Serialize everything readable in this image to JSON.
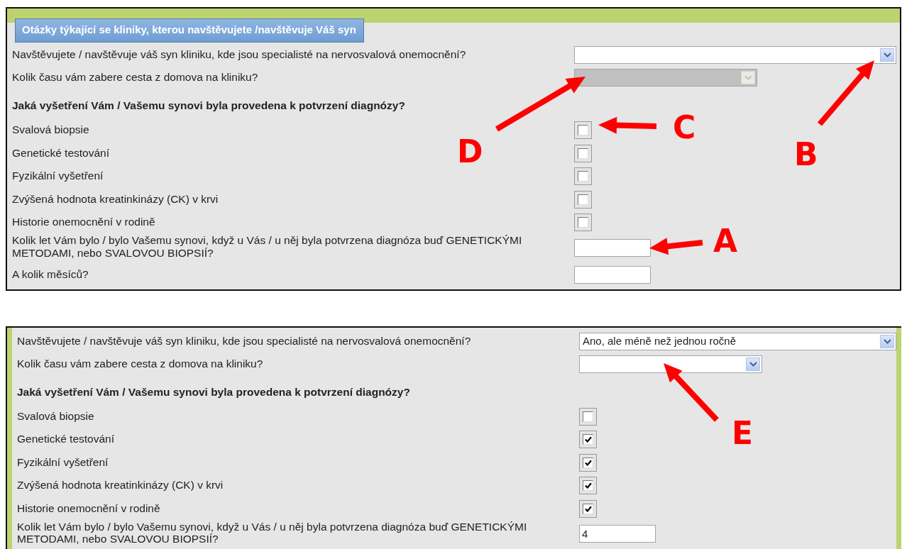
{
  "panels": [
    {
      "legend": "Otázky týkající se kliniky, kterou navštěvujete /navštěvuje Váš syn",
      "questions": [
        {
          "kind": "select",
          "label": "Navštěvujete / navštěvuje váš syn kliniku, kde jsou specialisté na nervosvalová onemocnění?",
          "disabled": false
        },
        {
          "kind": "smallselect",
          "label": "Kolik času vám zabere cesta z domova na kliniku?",
          "disabled": true
        },
        {
          "kind": "heading",
          "label": "Jaká vyšetření Vám / Vašemu synovi byla provedena k potvrzení diagnózy?"
        },
        {
          "kind": "checkbox",
          "label": "Svalová biopsie",
          "checked": false
        },
        {
          "kind": "checkbox",
          "label": "Genetické testování",
          "checked": false
        },
        {
          "kind": "checkbox",
          "label": "Fyzikální vyšetření",
          "checked": false
        },
        {
          "kind": "checkbox",
          "label": "Zvýšená hodnota kreatinkinázy (CK) v krvi",
          "checked": false
        },
        {
          "kind": "checkbox",
          "label": "Historie onemocnění v rodině",
          "checked": false
        },
        {
          "kind": "text",
          "label": "Kolik let Vám bylo / bylo Vašemu synovi, když u Vás / u něj byla potvrzena diagnóza buď GENETICKÝMI METODAMI, nebo SVALOVOU BIOPSIÍ?"
        },
        {
          "kind": "text",
          "label": "A kolik měsíců?"
        }
      ]
    },
    {
      "questions": [
        {
          "kind": "select",
          "label": "Navštěvujete / navštěvuje váš syn kliniku, kde jsou specialisté na nervosvalová onemocnění?",
          "value": "Ano, ale méně než jednou ročně",
          "disabled": false
        },
        {
          "kind": "smallselect",
          "label": "Kolik času vám zabere cesta z domova na kliniku?",
          "disabled": false
        },
        {
          "kind": "heading",
          "label": "Jaká vyšetření Vám / Vašemu synovi byla provedena k potvrzení diagnózy?"
        },
        {
          "kind": "checkbox",
          "label": "Svalová biopsie",
          "checked": false
        },
        {
          "kind": "checkbox",
          "label": "Genetické testování",
          "checked": true
        },
        {
          "kind": "checkbox",
          "label": "Fyzikální vyšetření",
          "checked": true
        },
        {
          "kind": "checkbox",
          "label": "Zvýšená hodnota kreatinkinázy (CK) v krvi",
          "checked": true
        },
        {
          "kind": "checkbox",
          "label": "Historie onemocnění v rodině",
          "checked": true
        },
        {
          "kind": "text",
          "label": "Kolik let Vám bylo / bylo Vašemu synovi, když u Vás / u něj byla potvrzena diagnóza buď GENETICKÝMI METODAMI, nebo SVALOVOU BIOPSIÍ?",
          "value": "4"
        }
      ]
    }
  ],
  "annotations": [
    {
      "label": "A"
    },
    {
      "label": "B"
    },
    {
      "label": "C"
    },
    {
      "label": "D"
    },
    {
      "label": "E"
    }
  ]
}
